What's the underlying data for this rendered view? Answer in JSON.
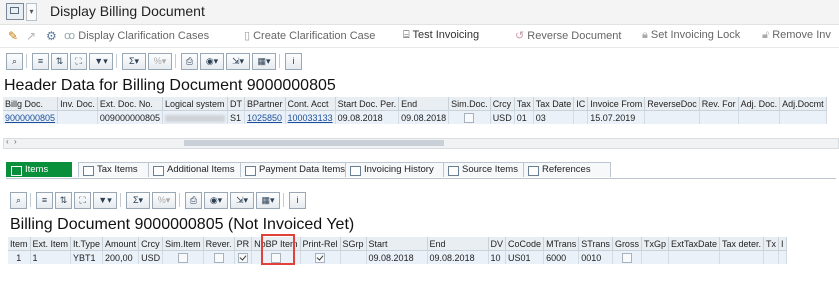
{
  "window": {
    "title": "Display Billing Document"
  },
  "toolbar": {
    "items": [
      {
        "label": "Display Clarification Cases"
      },
      {
        "label": "Create Clarification Case"
      },
      {
        "label": "Test Invoicing"
      },
      {
        "label": "Reverse Document"
      },
      {
        "label": "Set Invoicing Lock"
      },
      {
        "label": "Remove Inv"
      }
    ]
  },
  "header": {
    "title": "Header Data for Billing Document 9000000805",
    "columns": [
      "Billg Doc.",
      "Inv. Doc.",
      "Ext. Doc. No.",
      "Logical system",
      "DT",
      "BPartner",
      "Cont. Acct",
      "Start Doc. Per.",
      "End",
      "Sim.Doc.",
      "Crcy",
      "Tax",
      "Tax Date",
      "IC",
      "Invoice From",
      "ReverseDoc",
      "Rev. For",
      "Adj. Doc.",
      "Adj.Docmt"
    ],
    "row": {
      "billg_doc": "9000000805",
      "inv_doc": "",
      "ext_doc_no": "009000000805",
      "dt": "S1",
      "bpartner": "1025850",
      "cont_acct": "100033133",
      "start": "09.08.2018",
      "end": "09.08.2018",
      "crcy": "USD",
      "tax": "01",
      "ic": "03",
      "invoice_from": "15.07.2019"
    }
  },
  "tabs": [
    {
      "label": "Items",
      "selected": true
    },
    {
      "label": "Tax Items"
    },
    {
      "label": "Additional Items"
    },
    {
      "label": "Payment Data Items"
    },
    {
      "label": "Invoicing History"
    },
    {
      "label": "Source Items"
    },
    {
      "label": "References"
    }
  ],
  "items": {
    "title": "Billing Document 9000000805 (Not Invoiced Yet)",
    "columns": [
      "Item",
      "Ext. Item",
      "It.Type",
      "Amount",
      "Crcy",
      "Sim.Item",
      "Rever.",
      "PR",
      "NoBP Item",
      "Print-Rel",
      "SGrp",
      "Start",
      "End",
      "DV",
      "CoCode",
      "MTrans",
      "STrans",
      "Gross",
      "TxGp",
      "ExtTaxDate",
      "Tax deter.",
      "Tx",
      "I"
    ],
    "row": {
      "item": "1",
      "ext_item": "1",
      "it_type": "YBT1",
      "amount": "200,00",
      "crcy": "USD",
      "start": "09.08.2018",
      "end": "09.08.2018",
      "dv": "10",
      "cocode": "US01",
      "mtrans": "6000",
      "strans": "0010"
    }
  },
  "colors": {
    "accent_tab": "#0a8f3a",
    "highlight_box": "#e0423a",
    "grid_header": "#e9eef3",
    "grid_row": "#eaf1f8"
  }
}
